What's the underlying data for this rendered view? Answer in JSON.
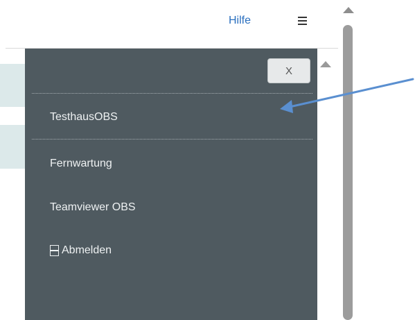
{
  "header": {
    "help_label": "Hilfe",
    "menu_icon": "hamburger-icon"
  },
  "menu": {
    "close_label": "X",
    "items": [
      {
        "label": "TesthausOBS"
      },
      {
        "label": "Fernwartung"
      },
      {
        "label": "Teamviewer OBS"
      },
      {
        "label": "Abmelden",
        "icon": "logout-icon"
      }
    ]
  },
  "colors": {
    "panel": "#4f5a60",
    "link": "#2a6fbf",
    "arrow": "#5a8fd0",
    "row_highlight": "#dce9ea"
  }
}
